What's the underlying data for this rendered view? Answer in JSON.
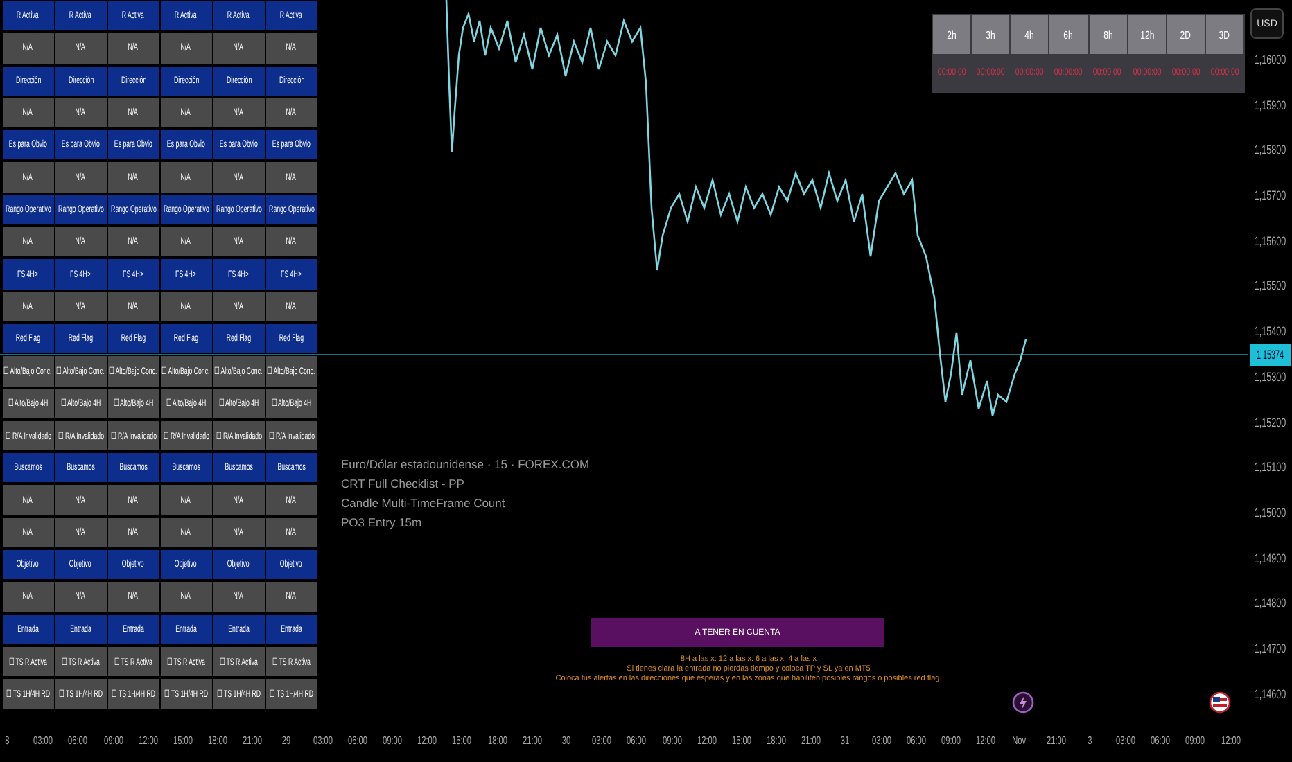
{
  "legend": [
    "Euro/Dólar estadounidense · 15 · FOREX.COM",
    "CRT Full Checklist - PP",
    "Candle Multi-TimeFrame Count",
    "PO3 Entry 15m"
  ],
  "checklist": [
    {
      "kind": "header",
      "cells": [
        "R Activa",
        "R Activa",
        "R Activa",
        "R Activa",
        "R Activa",
        "R Activa"
      ]
    },
    {
      "kind": "value",
      "cells": [
        "N/A",
        "N/A",
        "N/A",
        "N/A",
        "N/A",
        "N/A"
      ]
    },
    {
      "kind": "header",
      "cells": [
        "Dirección",
        "Dirección",
        "Dirección",
        "Dirección",
        "Dirección",
        "Dirección"
      ]
    },
    {
      "kind": "value",
      "cells": [
        "N/A",
        "N/A",
        "N/A",
        "N/A",
        "N/A",
        "N/A"
      ]
    },
    {
      "kind": "header",
      "cells": [
        "Es para Obvio",
        "Es para Obvio",
        "Es para Obvio",
        "Es para Obvio",
        "Es para Obvio",
        "Es para Obvio"
      ]
    },
    {
      "kind": "value",
      "cells": [
        "N/A",
        "N/A",
        "N/A",
        "N/A",
        "N/A",
        "N/A"
      ]
    },
    {
      "kind": "header",
      "cells": [
        "Rango Operativo",
        "Rango Operativo",
        "Rango Operativo",
        "Rango Operativo",
        "Rango Operativo",
        "Rango Operativo"
      ]
    },
    {
      "kind": "value",
      "cells": [
        "N/A",
        "N/A",
        "N/A",
        "N/A",
        "N/A",
        "N/A"
      ]
    },
    {
      "kind": "header",
      "cells": [
        "FS 4H>",
        "FS 4H>",
        "FS 4H>",
        "FS 4H>",
        "FS 4H>",
        "FS 4H>"
      ]
    },
    {
      "kind": "value",
      "cells": [
        "N/A",
        "N/A",
        "N/A",
        "N/A",
        "N/A",
        "N/A"
      ]
    },
    {
      "kind": "header",
      "cells": [
        "Red Flag",
        "Red Flag",
        "Red Flag",
        "Red Flag",
        "Red Flag",
        "Red Flag"
      ]
    },
    {
      "kind": "value",
      "cells": [
        "☐ Alto/Bajo Conc.",
        "☐ Alto/Bajo Conc.",
        "☐ Alto/Bajo Conc.",
        "☐ Alto/Bajo Conc.",
        "☐ Alto/Bajo Conc.",
        "☐ Alto/Bajo Conc."
      ]
    },
    {
      "kind": "value",
      "cells": [
        "☐ Alto/Bajo 4H",
        "☐ Alto/Bajo 4H",
        "☐ Alto/Bajo 4H",
        "☐ Alto/Bajo 4H",
        "☐ Alto/Bajo 4H",
        "☐ Alto/Bajo 4H"
      ]
    },
    {
      "kind": "value",
      "cells": [
        "☐ R/A Invalidado",
        "☐ R/A Invalidado",
        "☐ R/A Invalidado",
        "☐ R/A Invalidado",
        "☐ R/A Invalidado",
        "☐ R/A Invalidado"
      ]
    },
    {
      "kind": "header",
      "cells": [
        "Buscamos",
        "Buscamos",
        "Buscamos",
        "Buscamos",
        "Buscamos",
        "Buscamos"
      ]
    },
    {
      "kind": "value",
      "cells": [
        "N/A",
        "N/A",
        "N/A",
        "N/A",
        "N/A",
        "N/A"
      ]
    },
    {
      "kind": "value",
      "cells": [
        "N/A",
        "N/A",
        "N/A",
        "N/A",
        "N/A",
        "N/A"
      ]
    },
    {
      "kind": "header",
      "cells": [
        "Objetivo",
        "Objetivo",
        "Objetivo",
        "Objetivo",
        "Objetivo",
        "Objetivo"
      ]
    },
    {
      "kind": "value",
      "cells": [
        "N/A",
        "N/A",
        "N/A",
        "N/A",
        "N/A",
        "N/A"
      ]
    },
    {
      "kind": "header",
      "cells": [
        "Entrada",
        "Entrada",
        "Entrada",
        "Entrada",
        "Entrada",
        "Entrada"
      ]
    },
    {
      "kind": "value",
      "cells": [
        "☐ TS R Activa",
        "☐ TS R Activa",
        "☐ TS R Activa",
        "☐ TS R Activa",
        "☐ TS R Activa",
        "☐ TS R Activa"
      ]
    },
    {
      "kind": "value",
      "cells": [
        "☐ TS 1H/4H RD",
        "☐ TS 1H/4H RD",
        "☐ TS 1H/4H RD",
        "☐ TS 1H/4H RD",
        "☐ TS 1H/4H RD",
        "☐ TS 1H/4H RD"
      ]
    }
  ],
  "timeframes": [
    {
      "label": "2h",
      "countdown": "00:00:00"
    },
    {
      "label": "3h",
      "countdown": "00:00:00"
    },
    {
      "label": "4h",
      "countdown": "00:00:00"
    },
    {
      "label": "6h",
      "countdown": "00:00:00"
    },
    {
      "label": "8h",
      "countdown": "00:00:00"
    },
    {
      "label": "12h",
      "countdown": "00:00:00"
    },
    {
      "label": "2D",
      "countdown": "00:00:00"
    },
    {
      "label": "3D",
      "countdown": "00:00:00"
    }
  ],
  "note": {
    "title": "A TENER EN CUENTA",
    "lines": [
      "8H a las x: 12 a las x: 6 a las x: 4 a las x",
      "Si tienes clara la entrada no pierdas tiempo y coloca TP y SL ya en MT5",
      "Coloca tus alertas en las direcciones que esperas y en las zonas que habiliten posibles rangos o posibles red flag."
    ]
  },
  "price_axis": {
    "currency": "USD",
    "current_price": "1,15374",
    "labels": [
      "1,16000",
      "1,15900",
      "1,15800",
      "1,15700",
      "1,15600",
      "1,15500",
      "1,15400",
      "1,15300",
      "1,15200",
      "1,15100",
      "1,15000",
      "1,14900",
      "1,14800",
      "1,14700",
      "1,14600"
    ]
  },
  "time_axis": [
    "8",
    "03:00",
    "06:00",
    "09:00",
    "12:00",
    "15:00",
    "18:00",
    "21:00",
    "29",
    "03:00",
    "06:00",
    "09:00",
    "12:00",
    "15:00",
    "18:00",
    "21:00",
    "30",
    "03:00",
    "06:00",
    "09:00",
    "12:00",
    "15:00",
    "18:00",
    "21:00",
    "31",
    "03:00",
    "06:00",
    "09:00",
    "12:00",
    "Nov",
    "21:00",
    "3",
    "03:00",
    "06:00",
    "09:00",
    "12:00"
  ]
}
